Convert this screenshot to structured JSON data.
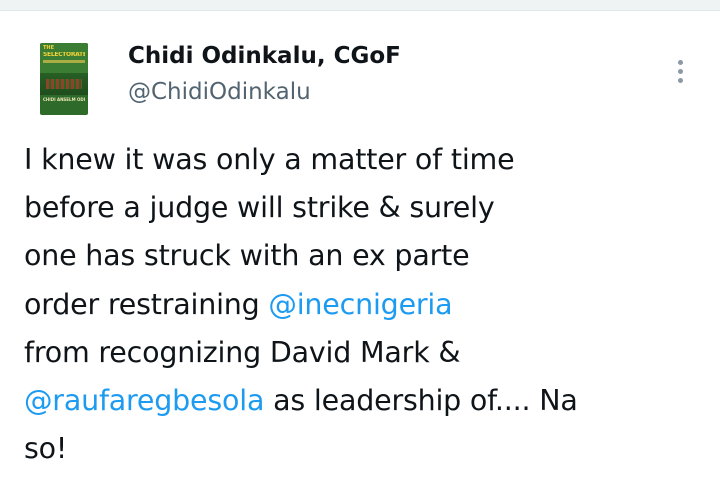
{
  "author": {
    "display_name": "Chidi Odinkalu, CGoF",
    "handle": "@ChidiOdinkalu",
    "avatar": {
      "cover_the": "THE",
      "cover_title": "SELECTORATE",
      "cover_author": "CHIDI ANSELM ODINKALU"
    }
  },
  "menu": {
    "icon": "more-vertical-icon"
  },
  "tweet": {
    "lines": [
      {
        "segments": [
          {
            "text": "I knew it was only a matter of time",
            "type": "text"
          }
        ]
      },
      {
        "segments": [
          {
            "text": "before a judge will strike & surely",
            "type": "text"
          }
        ]
      },
      {
        "segments": [
          {
            "text": "one has struck with an ex parte",
            "type": "text"
          }
        ]
      },
      {
        "segments": [
          {
            "text": "order restraining ",
            "type": "text"
          },
          {
            "text": "@inecnigeria",
            "type": "mention"
          }
        ]
      },
      {
        "segments": [
          {
            "text": "from recognizing David Mark &",
            "type": "text"
          }
        ]
      },
      {
        "segments": [
          {
            "text": "@raufaregbesola",
            "type": "mention"
          },
          {
            "text": " as leadership of.... Na",
            "type": "text"
          }
        ]
      },
      {
        "segments": [
          {
            "text": "so!",
            "type": "text"
          }
        ]
      }
    ]
  },
  "colors": {
    "text": "#0f1419",
    "secondary": "#536471",
    "link": "#1d9bf0",
    "divider": "#eff3f4"
  }
}
